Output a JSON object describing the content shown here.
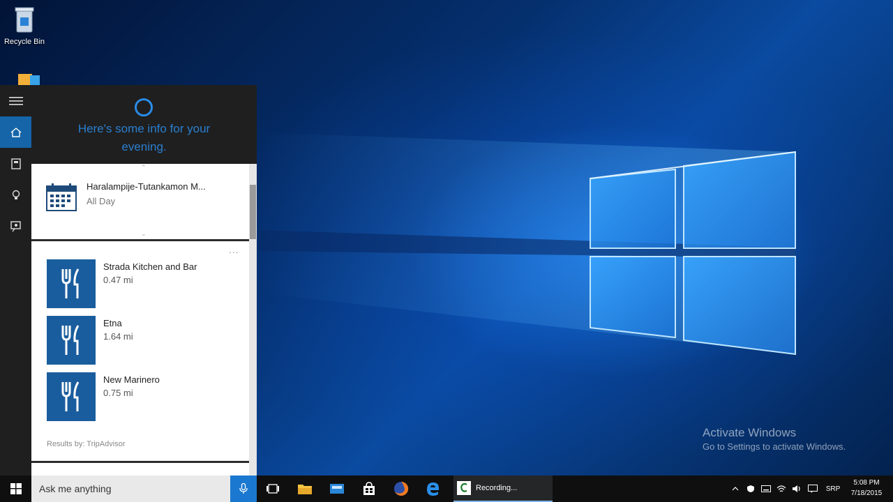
{
  "desktop": {
    "icons": [
      {
        "label": "Recycle Bin",
        "icon": "recycle-bin-icon"
      },
      {
        "label": "",
        "icon": "folder-icon"
      }
    ],
    "watermark": {
      "title": "Activate Windows",
      "subtitle": "Go to Settings to activate Windows."
    },
    "wallpaper_colors": {
      "deep": "#021437",
      "mid": "#0a4aa0",
      "glow": "#3fb4ff"
    }
  },
  "cortana": {
    "greeting": "Here's some info for your evening.",
    "accent": "#1565a8",
    "rail": [
      {
        "name": "menu",
        "icon": "hamburger-icon"
      },
      {
        "name": "home",
        "icon": "home-icon",
        "active": true
      },
      {
        "name": "notebook",
        "icon": "notebook-icon"
      },
      {
        "name": "reminders",
        "icon": "lightbulb-icon"
      },
      {
        "name": "feedback",
        "icon": "feedback-icon"
      }
    ],
    "event": {
      "title": "Haralampije-Tutankamon M...",
      "subtitle": "All Day",
      "icon": "calendar-icon"
    },
    "restaurants": {
      "more_label": "...",
      "items": [
        {
          "name": "Strada Kitchen and Bar",
          "distance": "0.47 mi",
          "icon": "fork-knife-icon"
        },
        {
          "name": "Etna",
          "distance": "1.64 mi",
          "icon": "fork-knife-icon"
        },
        {
          "name": "New Marinero",
          "distance": "0.75 mi",
          "icon": "fork-knife-icon"
        }
      ],
      "source": "Results by: TripAdvisor"
    }
  },
  "taskbar": {
    "search_placeholder": "Ask me anything",
    "apps": [
      {
        "name": "task-view",
        "icon": "task-view-icon"
      },
      {
        "name": "file-explorer",
        "icon": "folder-icon"
      },
      {
        "name": "photos",
        "icon": "photos-icon"
      },
      {
        "name": "store",
        "icon": "store-icon"
      },
      {
        "name": "firefox",
        "icon": "firefox-icon"
      },
      {
        "name": "edge",
        "icon": "edge-icon"
      }
    ],
    "recording": {
      "label": "Recording...",
      "icon": "recorder-icon"
    },
    "tray": {
      "language": "SRP",
      "time": "5:08 PM",
      "date": "7/18/2015"
    }
  }
}
